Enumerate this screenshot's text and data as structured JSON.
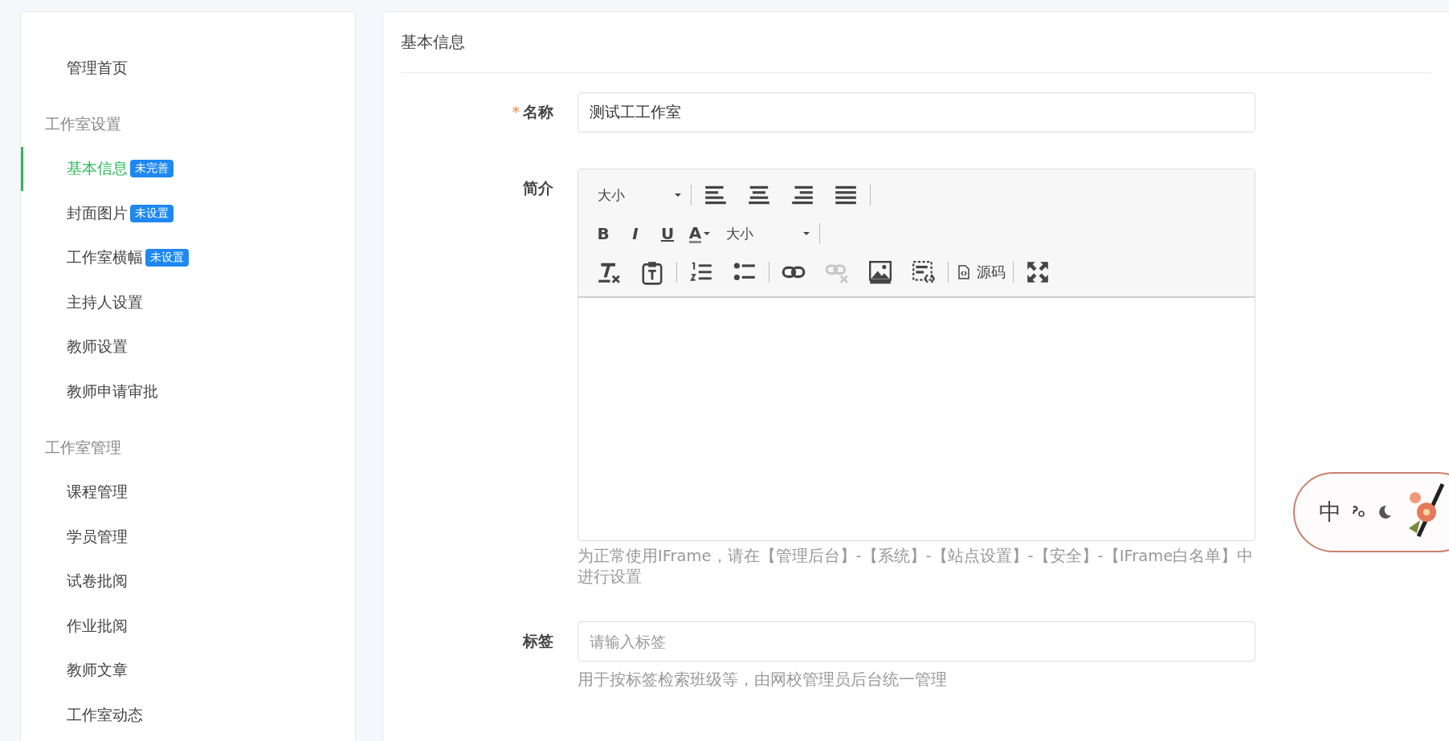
{
  "sidebar": {
    "items": [
      {
        "kind": "link",
        "label": "管理首页",
        "selected": false
      },
      {
        "kind": "group",
        "label": "工作室设置"
      },
      {
        "kind": "link",
        "label": "基本信息",
        "selected": true,
        "badge": "未完善"
      },
      {
        "kind": "link",
        "label": "封面图片",
        "selected": false,
        "badge": "未设置"
      },
      {
        "kind": "link",
        "label": "工作室横幅",
        "selected": false,
        "badge": "未设置"
      },
      {
        "kind": "link",
        "label": "主持人设置",
        "selected": false
      },
      {
        "kind": "link",
        "label": "教师设置",
        "selected": false
      },
      {
        "kind": "link",
        "label": "教师申请审批",
        "selected": false
      },
      {
        "kind": "group",
        "label": "工作室管理"
      },
      {
        "kind": "link",
        "label": "课程管理",
        "selected": false
      },
      {
        "kind": "link",
        "label": "学员管理",
        "selected": false
      },
      {
        "kind": "link",
        "label": "试卷批阅",
        "selected": false
      },
      {
        "kind": "link",
        "label": "作业批阅",
        "selected": false
      },
      {
        "kind": "link",
        "label": "教师文章",
        "selected": false
      },
      {
        "kind": "link",
        "label": "工作室动态",
        "selected": false
      }
    ]
  },
  "main": {
    "title": "基本信息",
    "name_field": {
      "label": "名称",
      "required": true,
      "required_mark": "*",
      "value": "测试工工作室"
    },
    "intro_field": {
      "label": "简介",
      "help": "为正常使用IFrame，请在【管理后台】-【系统】-【站点设置】-【安全】-【IFrame白名单】中进行设置",
      "toolbar": [
        [
          {
            "kind": "dropdown",
            "label": "大小"
          },
          {
            "kind": "separator"
          },
          {
            "kind": "align-left",
            "disabled": false
          },
          {
            "kind": "align-center",
            "disabled": false
          },
          {
            "kind": "align-right",
            "disabled": false
          },
          {
            "kind": "justify",
            "disabled": false
          },
          {
            "kind": "separator"
          }
        ],
        [
          {
            "kind": "letter",
            "label": "B",
            "disabled": false
          },
          {
            "kind": "letter",
            "label": "I",
            "disabled": false
          },
          {
            "kind": "letter",
            "label": "U",
            "disabled": false
          },
          {
            "kind": "font-color",
            "label": "A",
            "disabled": false
          },
          {
            "kind": "dropdown",
            "label": "大小"
          },
          {
            "kind": "separator"
          }
        ],
        [
          {
            "kind": "clear-format",
            "disabled": false
          },
          {
            "kind": "paste-text",
            "disabled": false
          },
          {
            "kind": "separator"
          },
          {
            "kind": "ordered-list",
            "disabled": false
          },
          {
            "kind": "bullet-list",
            "disabled": false
          },
          {
            "kind": "separator"
          },
          {
            "kind": "link",
            "disabled": false
          },
          {
            "kind": "unlink",
            "disabled": true
          },
          {
            "kind": "image",
            "disabled": false
          },
          {
            "kind": "template",
            "disabled": false
          },
          {
            "kind": "separator"
          },
          {
            "kind": "source",
            "label": "源码",
            "disabled": false
          },
          {
            "kind": "separator"
          },
          {
            "kind": "fullscreen",
            "disabled": false
          }
        ]
      ]
    },
    "tag_field": {
      "label": "标签",
      "placeholder": "请输入标签",
      "help": "用于按标签检索班级等，由网校管理员后台统一管理"
    }
  },
  "floating_widget": {
    "language": "中"
  }
}
